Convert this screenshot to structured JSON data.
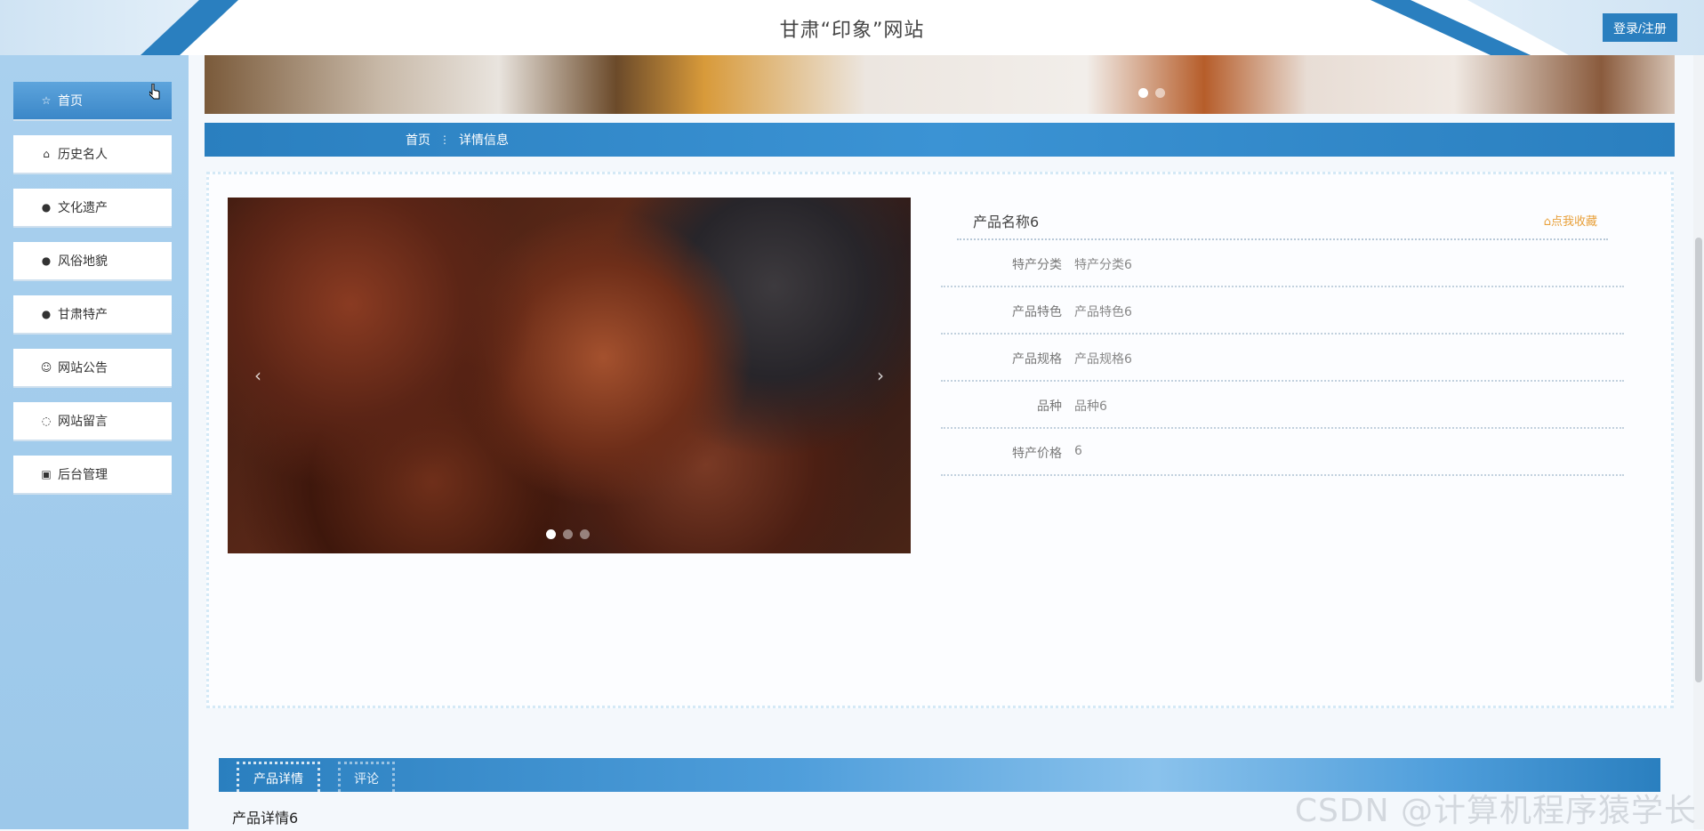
{
  "header": {
    "title": "甘肃“印象”网站",
    "login_label": "登录/注册"
  },
  "sidebar": {
    "items": [
      {
        "label": "首页",
        "icon": "star-icon",
        "active": true
      },
      {
        "label": "历史名人",
        "icon": "bag-icon"
      },
      {
        "label": "文化遗产",
        "icon": "exclamation-icon"
      },
      {
        "label": "风俗地貌",
        "icon": "question-icon"
      },
      {
        "label": "甘肃特产",
        "icon": "info-icon"
      },
      {
        "label": "网站公告",
        "icon": "smile-icon"
      },
      {
        "label": "网站留言",
        "icon": "chat-icon"
      },
      {
        "label": "后台管理",
        "icon": "gift-icon"
      }
    ]
  },
  "breadcrumb": {
    "home": "首页",
    "separator": "⋮",
    "current": "详情信息"
  },
  "product": {
    "name": "产品名称6",
    "favorite_label": "⌂点我收藏",
    "fields": [
      {
        "label": "特产分类",
        "value": "特产分类6"
      },
      {
        "label": "产品特色",
        "value": "产品特色6"
      },
      {
        "label": "产品规格",
        "value": "产品规格6"
      },
      {
        "label": "品种",
        "value": "品种6"
      },
      {
        "label": "特产价格",
        "value": "6"
      }
    ]
  },
  "tabs": {
    "details": "产品详情",
    "comments": "评论"
  },
  "detail_text": "产品详情6",
  "watermark": "CSDN @计算机程序猿学长",
  "colors": {
    "primary": "#2a7fbf",
    "sidebar_bg": "#a9d0ee",
    "favorite": "#e8a03a"
  }
}
